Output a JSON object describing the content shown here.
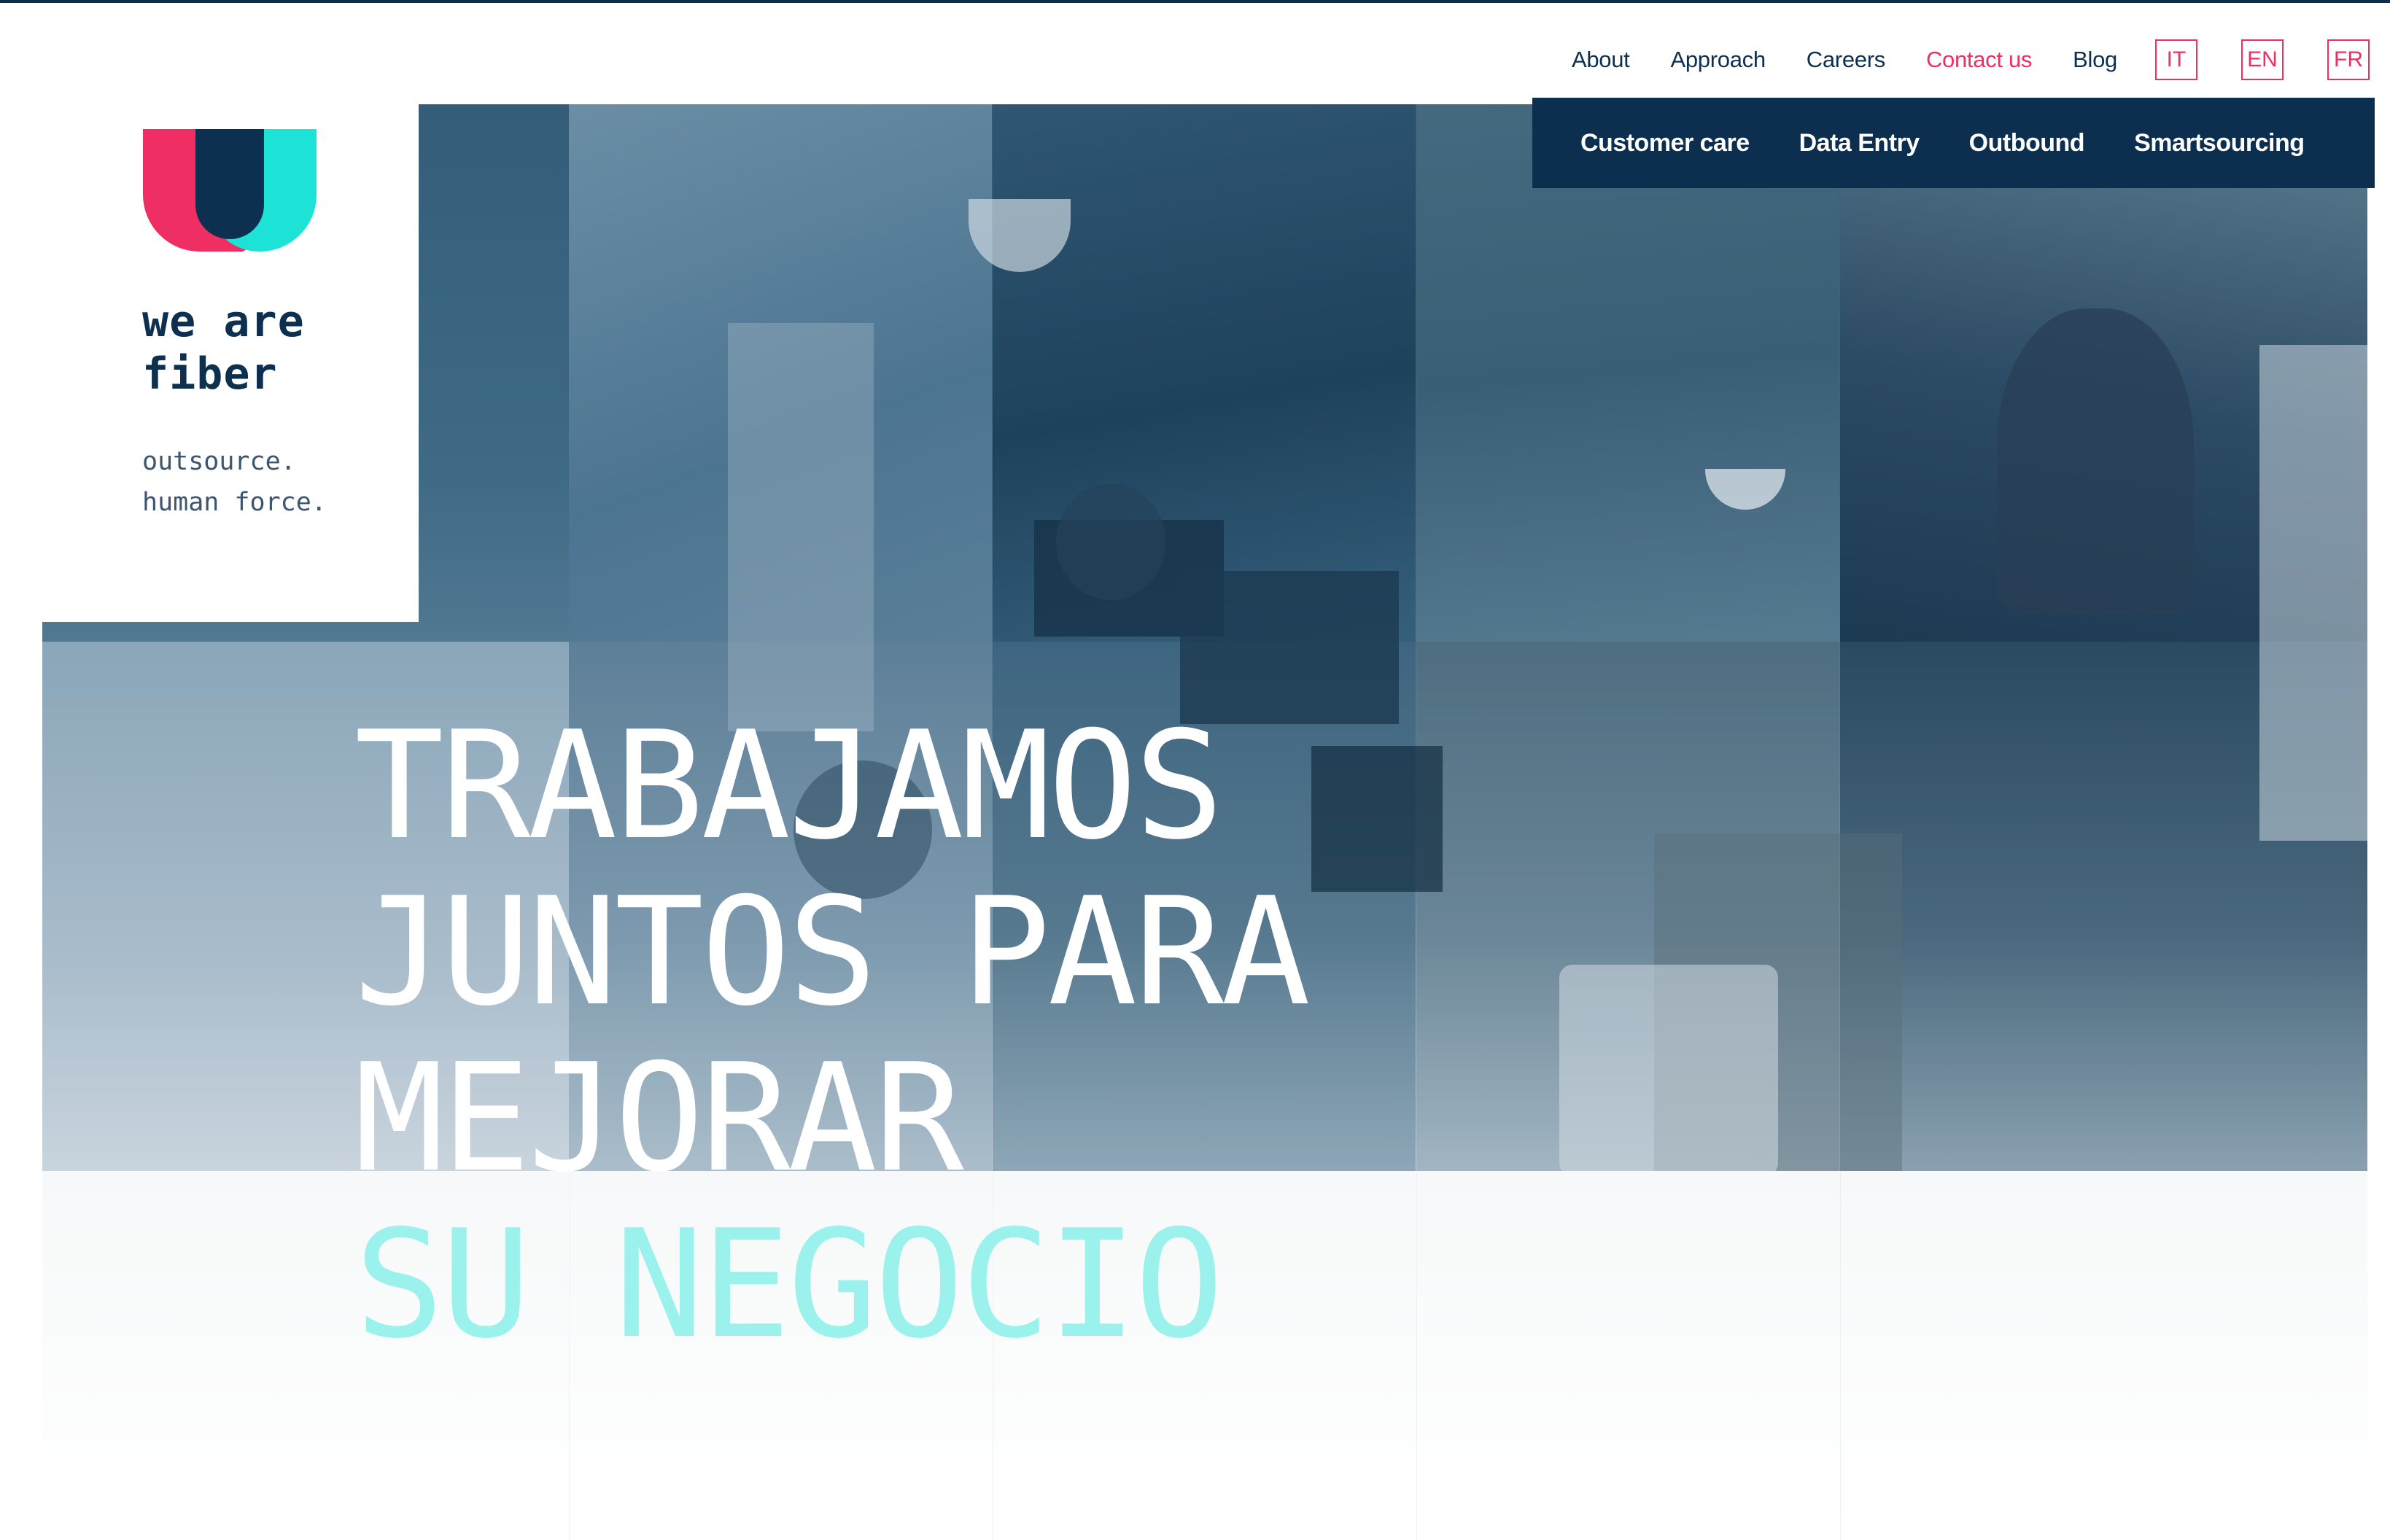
{
  "brand": {
    "name_line1": "we are",
    "name_line2": "fiber",
    "tagline_line1": "outsource.",
    "tagline_line2": "human force.",
    "colors": {
      "pink": "#ef2e63",
      "navy": "#0d3050",
      "cyan": "#1de3d6"
    }
  },
  "topnav": {
    "links": [
      "About",
      "Approach",
      "Careers",
      "Contact us",
      "Blog"
    ],
    "languages": [
      "IT",
      "EN",
      "FR"
    ],
    "accent_color": "#ef2e63"
  },
  "services": {
    "items": [
      "Customer care",
      "Data Entry",
      "Outbound",
      "Smartsourcing"
    ],
    "background": "#0d2f4f"
  },
  "hero": {
    "line1": "TRABAJAMOS",
    "line2": "JUNTOS PARA",
    "line3": "MEJORAR",
    "line4": "SU NEGOCIO",
    "accent_color": "#9bf1ec"
  }
}
